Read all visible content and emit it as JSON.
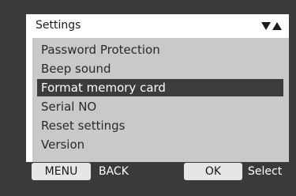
{
  "header": {
    "title": "Settings",
    "scroll_icon": "up-down-arrows-icon"
  },
  "menu": {
    "items": [
      {
        "label": "Password Protection",
        "selected": false
      },
      {
        "label": "Beep sound",
        "selected": false
      },
      {
        "label": "Format memory card",
        "selected": true
      },
      {
        "label": "Serial NO",
        "selected": false
      },
      {
        "label": "Reset settings",
        "selected": false
      },
      {
        "label": "Version",
        "selected": false
      }
    ]
  },
  "footer": {
    "menu_key": "MENU",
    "menu_action": "BACK",
    "ok_key": "OK",
    "ok_action": "Select"
  },
  "colors": {
    "background": "#3a3a3a",
    "panel": "#ffffff",
    "list": "#c9c9c9",
    "selected": "#3c3c3c"
  }
}
